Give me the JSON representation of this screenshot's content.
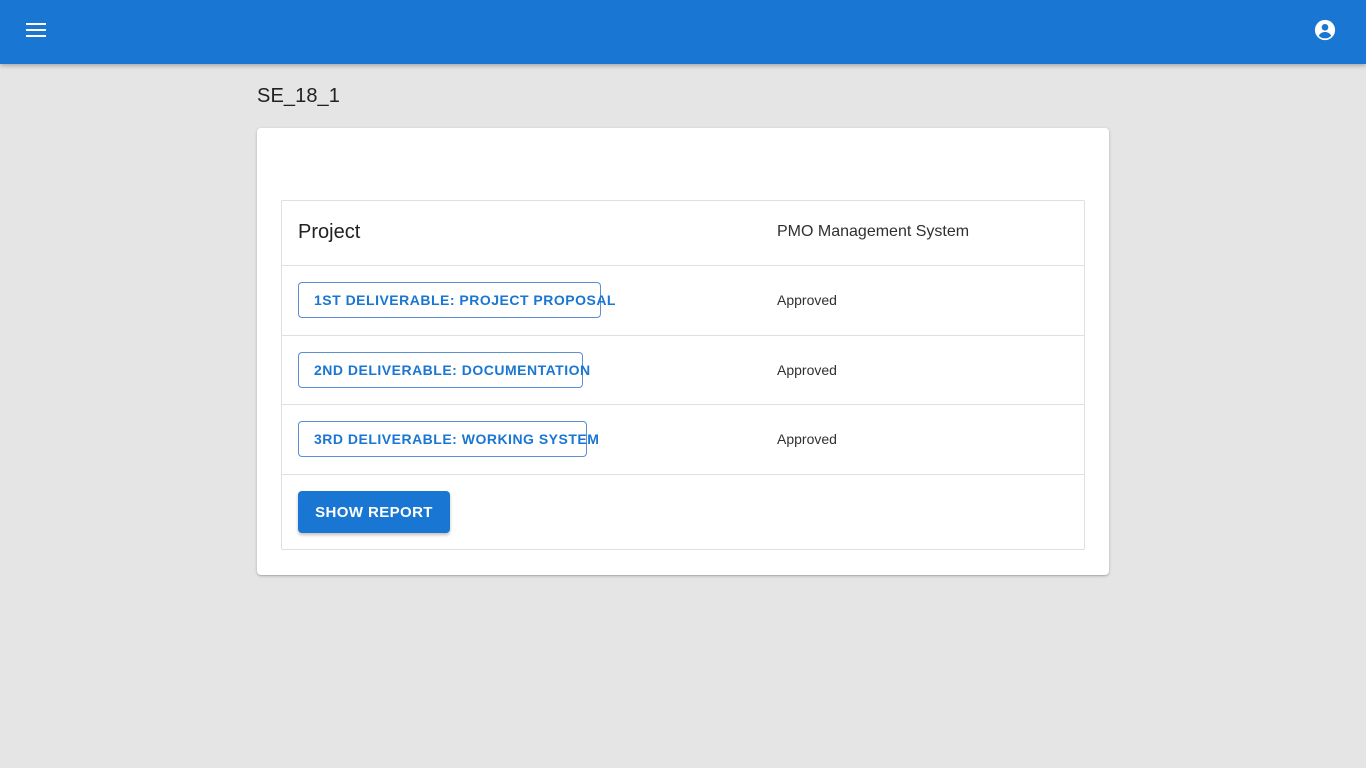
{
  "appbar": {
    "menu_icon": "menu-icon",
    "account_icon": "account-circle-icon",
    "color": "#1976d2"
  },
  "page": {
    "title": "SE_18_1"
  },
  "table": {
    "header": {
      "label": "Project",
      "value": "PMO Management System"
    },
    "rows": [
      {
        "deliverable": "1st Deliverable: Project Proposal",
        "status": "Approved"
      },
      {
        "deliverable": "2nd Deliverable: Documentation",
        "status": "Approved"
      },
      {
        "deliverable": "3rd Deliverable: Working System",
        "status": "Approved"
      }
    ],
    "show_report_label": "Show Report"
  }
}
